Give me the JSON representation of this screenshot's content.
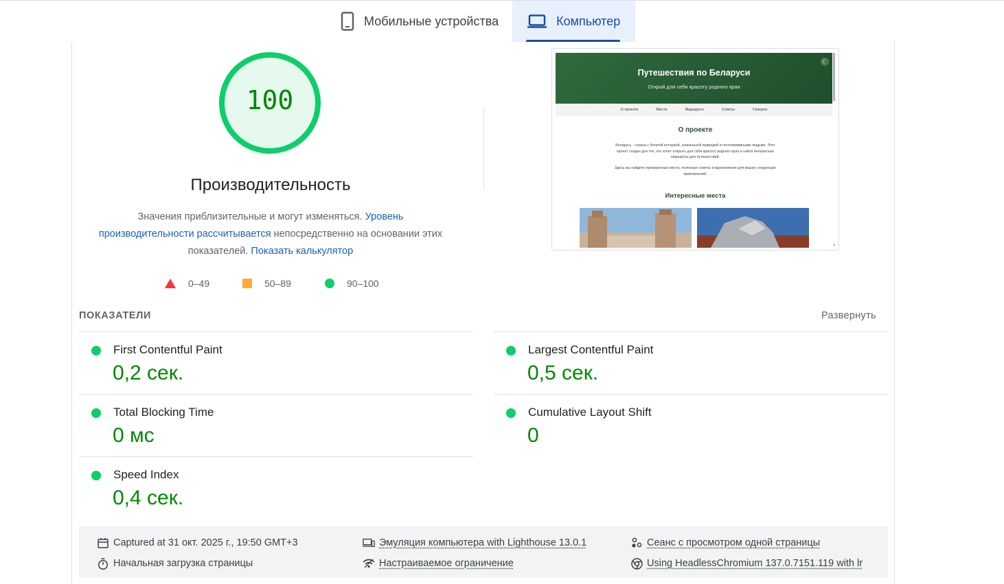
{
  "tabs": [
    {
      "label": "Мобильные устройства",
      "icon": "smartphone-icon",
      "active": false
    },
    {
      "label": "Компьютер",
      "icon": "laptop-icon",
      "active": true
    }
  ],
  "score": {
    "value": "100",
    "level": 1.0,
    "color": "#0cce6b"
  },
  "category": {
    "title": "Производительность",
    "desc_1": "Значения приблизительные и могут изменяться. ",
    "link_1": "Уровень производительности рассчитывается",
    "desc_2": " непосредственно на основании этих показателей. ",
    "link_2": "Показать калькулятор"
  },
  "legend": [
    {
      "range": "0–49",
      "shape": "triangle",
      "color": "#ff3333"
    },
    {
      "range": "50–89",
      "shape": "square",
      "color": "#ffaa33"
    },
    {
      "range": "90–100",
      "shape": "circle",
      "color": "#0cce6b"
    }
  ],
  "preview": {
    "hero_title": "Путешествия по Беларуси",
    "hero_subtitle": "Открой для себя красоту родного края",
    "nav": [
      "О проекте",
      "Места",
      "Маршруты",
      "Советы",
      "Галерея"
    ],
    "about_title": "О проекте",
    "about_text_1": "Беларусь - страна с богатой историей, уникальной природой и гостеприимными людьми. Этот проект создан для тех, кто хочет открыть для себя красоту родного края и найти интересные маршруты для путешествий.",
    "about_text_2": "Здесь вы найдете проверенные места, полезные советы и вдохновение для ваших следующих приключений.",
    "places_title": "Интересные места"
  },
  "metrics": {
    "title": "ПОКАЗАТЕЛИ",
    "expand_label": "Развернуть",
    "items": [
      {
        "label": "First Contentful Paint",
        "value": "0,2 сек."
      },
      {
        "label": "Largest Contentful Paint",
        "value": "0,5 сек."
      },
      {
        "label": "Total Blocking Time",
        "value": "0 мс"
      },
      {
        "label": "Cumulative Layout Shift",
        "value": "0"
      },
      {
        "label": "Speed Index",
        "value": "0,4 сек."
      }
    ],
    "status_color": "#0cce6b",
    "value_color": "#008800"
  },
  "info": {
    "captured": "Captured at 31 окт. 2025 г., 19:50 GMT+3",
    "load": "Начальная загрузка страницы",
    "emulation": "Эмуляция компьютера with Lighthouse 13.0.1",
    "throttling": "Настраиваемое ограничение",
    "session": "Сеанс с просмотром одной страницы",
    "browser": "Using HeadlessChromium 137.0.7151.119 with lr"
  }
}
